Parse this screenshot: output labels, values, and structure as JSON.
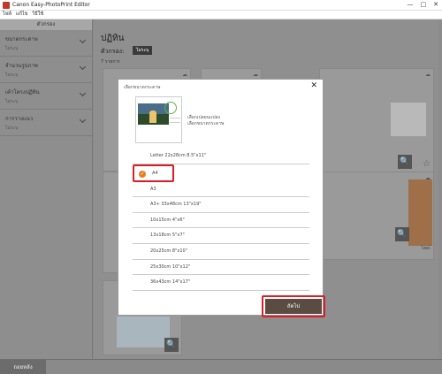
{
  "window": {
    "title": "Canon Easy-PhotoPrint Editor",
    "controls": [
      "—",
      "□",
      "✕"
    ]
  },
  "menu": [
    "ไฟล์",
    "แก้ไข",
    "วิธีใช้"
  ],
  "sidebar": {
    "title": "ตัวกรอง",
    "items": [
      {
        "label": "ขนาดกระดาษ",
        "value": "ไม่ระบุ"
      },
      {
        "label": "จำนวนรูปภาพ",
        "value": "ไม่ระบุ"
      },
      {
        "label": "เค้าโครงปฏิทิน",
        "value": "ไม่ระบุ"
      },
      {
        "label": "การวางแนว",
        "value": "ไม่ระบุ"
      }
    ]
  },
  "main": {
    "title": "ปฏิทิน",
    "filter_label": "ตัวกรอง:",
    "filter_chip": "ไม่ระบุ",
    "count": "7 รายการ",
    "card_caption": "ไฮดเ้"
  },
  "bottombar": {
    "back": "ถอยหลัง"
  },
  "dialog": {
    "title": "เลือกขนาดกระดาษ",
    "close": "✕",
    "preview_text_1": "เลือกเปลยนแปลง",
    "preview_text_2": "เลือกขนาดกระดาษ",
    "sizes": [
      "Letter 22x28cm 8.5\"x11\"",
      "A4",
      "A3",
      "A3+ 33x48cm 13\"x19\"",
      "10x15cm 4\"x6\"",
      "13x18cm 5\"x7\"",
      "20x25cm 8\"x10\"",
      "25x30cm 10\"x12\"",
      "36x43cm 14\"x17\""
    ],
    "selected_index": 1,
    "next_label": "ถัดไป"
  },
  "icons": {
    "cloud": "cloud-icon",
    "zoom": "zoom-icon",
    "star": "star-icon",
    "check": "check-icon",
    "close": "close-icon"
  },
  "colors": {
    "highlight": "#d61f26",
    "check": "#e67e22",
    "next_button": "#5a4b43"
  }
}
